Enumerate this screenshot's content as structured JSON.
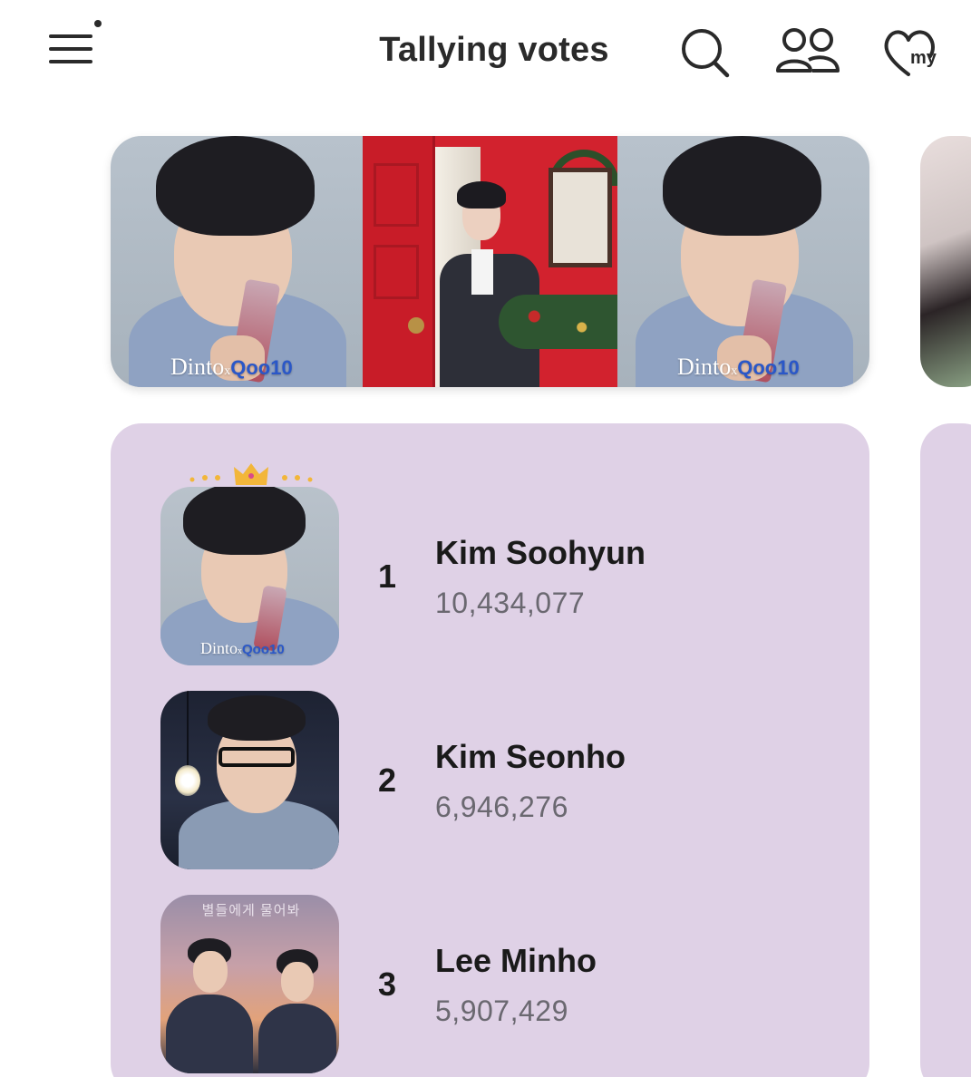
{
  "header": {
    "title": "Tallying votes",
    "icons": [
      "menu-icon",
      "search-icon",
      "people-icon",
      "heart-my-icon"
    ],
    "my_label": "my"
  },
  "banner": {
    "brand_text": "Dinto",
    "brand_x": "x",
    "brand_partner": "Qoo10"
  },
  "ranking": [
    {
      "rank": "1",
      "name": "Kim Soohyun",
      "votes": "10,434,077"
    },
    {
      "rank": "2",
      "name": "Kim Seonho",
      "votes": "6,946,276"
    },
    {
      "rank": "3",
      "name": "Lee Minho",
      "votes": "5,907,429"
    }
  ],
  "avatar3_title": "별들에게 물어봐",
  "colors": {
    "card_bg": "#dfd1e6",
    "text_primary": "#1a1a1a",
    "text_secondary": "#6a6870",
    "crown": "#f2b63a"
  }
}
